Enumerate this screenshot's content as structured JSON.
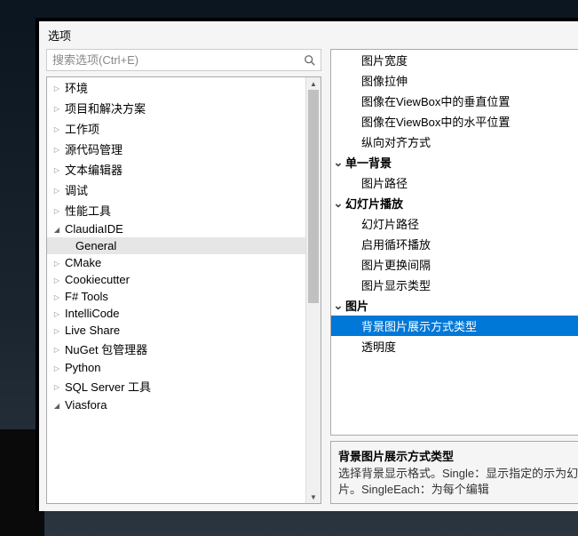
{
  "title": "选项",
  "search": {
    "placeholder": "搜索选项(Ctrl+E)"
  },
  "tree": [
    {
      "label": "环境",
      "state": "collapsed"
    },
    {
      "label": "项目和解决方案",
      "state": "collapsed"
    },
    {
      "label": "工作项",
      "state": "collapsed"
    },
    {
      "label": "源代码管理",
      "state": "collapsed"
    },
    {
      "label": "文本编辑器",
      "state": "collapsed"
    },
    {
      "label": "调试",
      "state": "collapsed"
    },
    {
      "label": "性能工具",
      "state": "collapsed"
    },
    {
      "label": "ClaudiaIDE",
      "state": "expanded"
    },
    {
      "label": "General",
      "state": "child"
    },
    {
      "label": "CMake",
      "state": "collapsed"
    },
    {
      "label": "Cookiecutter",
      "state": "collapsed"
    },
    {
      "label": "F# Tools",
      "state": "collapsed"
    },
    {
      "label": "IntelliCode",
      "state": "collapsed"
    },
    {
      "label": "Live Share",
      "state": "collapsed"
    },
    {
      "label": "NuGet 包管理器",
      "state": "collapsed"
    },
    {
      "label": "Python",
      "state": "collapsed"
    },
    {
      "label": "SQL Server 工具",
      "state": "collapsed"
    },
    {
      "label": "Viasfora",
      "state": "expanded"
    }
  ],
  "props": [
    {
      "label": "图片宽度",
      "type": "item"
    },
    {
      "label": "图像拉伸",
      "type": "item"
    },
    {
      "label": "图像在ViewBox中的垂直位置",
      "type": "item"
    },
    {
      "label": "图像在ViewBox中的水平位置",
      "type": "item"
    },
    {
      "label": "纵向对齐方式",
      "type": "item"
    },
    {
      "label": "单一背景",
      "type": "cat"
    },
    {
      "label": "图片路径",
      "type": "item"
    },
    {
      "label": "幻灯片播放",
      "type": "cat"
    },
    {
      "label": "幻灯片路径",
      "type": "item"
    },
    {
      "label": "启用循环播放",
      "type": "item"
    },
    {
      "label": "图片更换间隔",
      "type": "item"
    },
    {
      "label": "图片显示类型",
      "type": "item"
    },
    {
      "label": "图片",
      "type": "cat"
    },
    {
      "label": "背景图片展示方式类型",
      "type": "item",
      "selected": true
    },
    {
      "label": "透明度",
      "type": "item"
    }
  ],
  "desc": {
    "title": "背景图片展示方式类型",
    "text": "选择背景显示格式。Single：显示指定的示为幻灯片。SingleEach：为每个编辑"
  }
}
